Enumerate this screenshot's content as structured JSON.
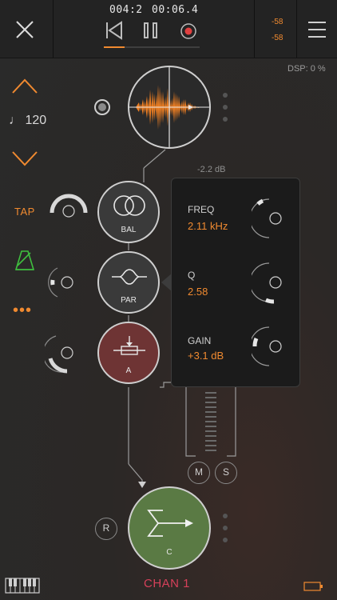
{
  "transport": {
    "position": "004:2",
    "time": "00:06.4"
  },
  "meters": {
    "left": "-58",
    "right": "-58"
  },
  "dsp": "DSP: 0 %",
  "tempo": {
    "value": "♩ 120"
  },
  "tap_label": "TAP",
  "more_label": "•••",
  "nodes": {
    "bal": "BAL",
    "par": "PAR",
    "a": "A",
    "c": "C"
  },
  "eq_popup": {
    "gain_readout": "-2.2 dB",
    "params": [
      {
        "label": "FREQ",
        "value": "2.11 kHz"
      },
      {
        "label": "Q",
        "value": "2.58"
      },
      {
        "label": "GAIN",
        "value": "+3.1 dB"
      }
    ]
  },
  "buttons": {
    "mute": "M",
    "solo": "S",
    "record": "R"
  },
  "channel_name": "CHAN 1",
  "colors": {
    "accent": "#f08a30",
    "green": "#3fbf3f",
    "channel": "#d6405a",
    "node_red": "#6e3434",
    "node_green": "#5a7a44"
  }
}
